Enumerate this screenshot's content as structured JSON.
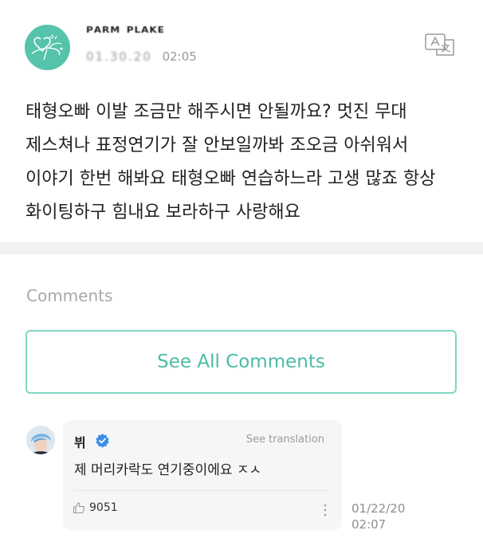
{
  "post": {
    "author": "ᴾᴬᴿᴹ ᴾᴸᴬᴷᴱ",
    "date": "01.30.20",
    "time": "02:05",
    "body": "태형오빠 이발 조금만 해주시면 안될까요? 멋진 무대 제스쳐나 표정연기가 잘 안보일까봐 조오금 아쉬워서 이야기 한번 해봐요 태형오빠 연습하느라 고생 많죠 항상 화이팅하구 힘내요 보라하구 사랑해요",
    "translate_icon": "translate-icon",
    "avatar_icon": "heart-logo-avatar"
  },
  "comments_section": {
    "label": "Comments",
    "see_all_label": "See All Comments"
  },
  "comment": {
    "author": "뷔",
    "verified_icon": "verified-check-icon",
    "see_translation": "See translation",
    "text": "제 머리카락도 연기중이에요 ㅈㅅ",
    "likes": "9051",
    "like_icon": "thumbs-up-icon",
    "more_icon": "more-vertical-icon",
    "date": "01/22/20",
    "time": "02:07"
  },
  "colors": {
    "accent": "#4bbca4",
    "accent_border": "#7fd6c3",
    "avatar_bg": "#56c3ab",
    "verified": "#3d8ee6",
    "muted": "#a8a8a8"
  }
}
